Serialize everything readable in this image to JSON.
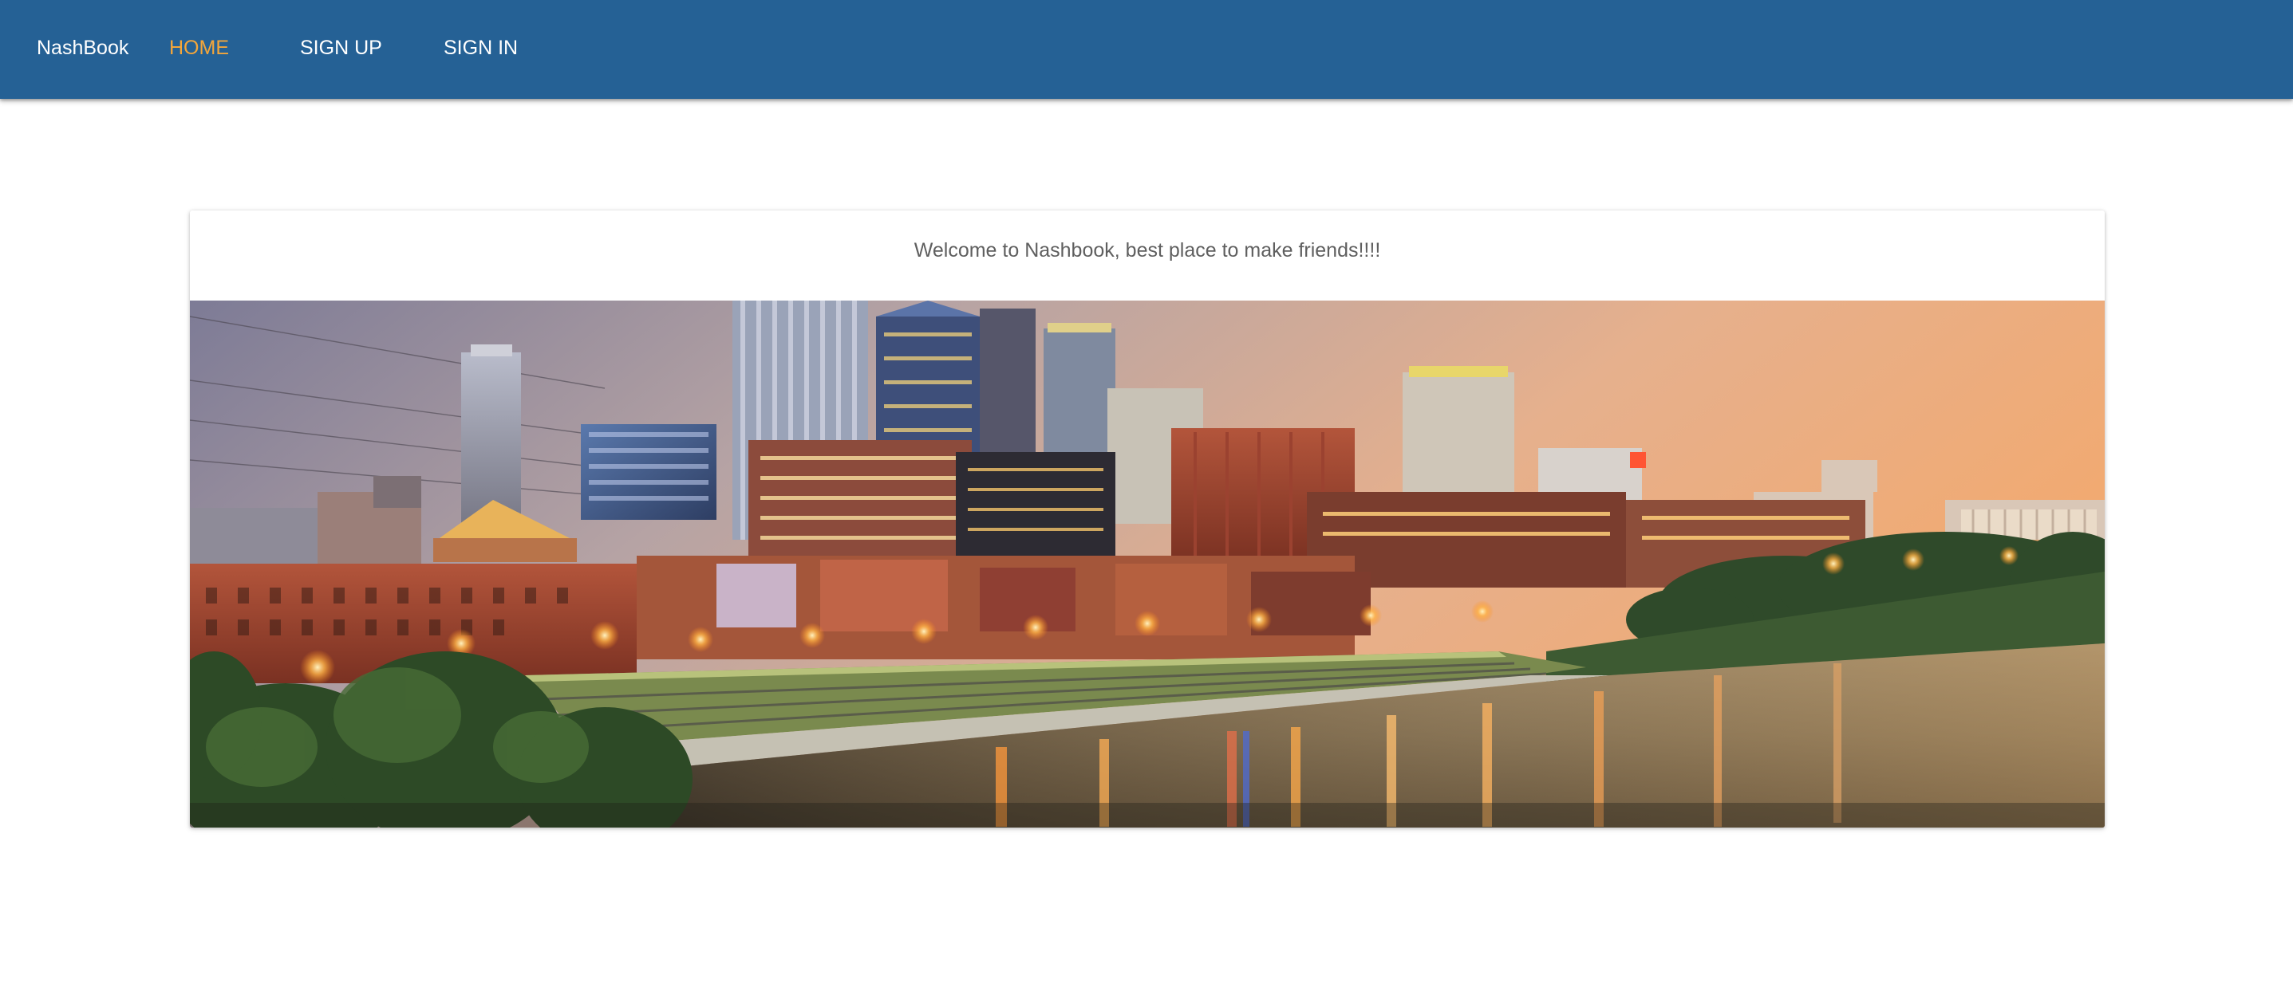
{
  "header": {
    "brand": "NashBook",
    "nav": {
      "home": "HOME",
      "signup": "SIGN UP",
      "signin": "SIGN IN"
    },
    "active_item": "HOME"
  },
  "main": {
    "welcome_text": "Welcome to Nashbook, best place to make friends!!!!",
    "image": {
      "subject": "Nashville skyline at dusk along the Cumberland River"
    }
  },
  "colors": {
    "appbar": "#256195",
    "active_nav": "#f4a63a",
    "nav_text": "#ffffff",
    "body_text": "#5f5f5f"
  }
}
